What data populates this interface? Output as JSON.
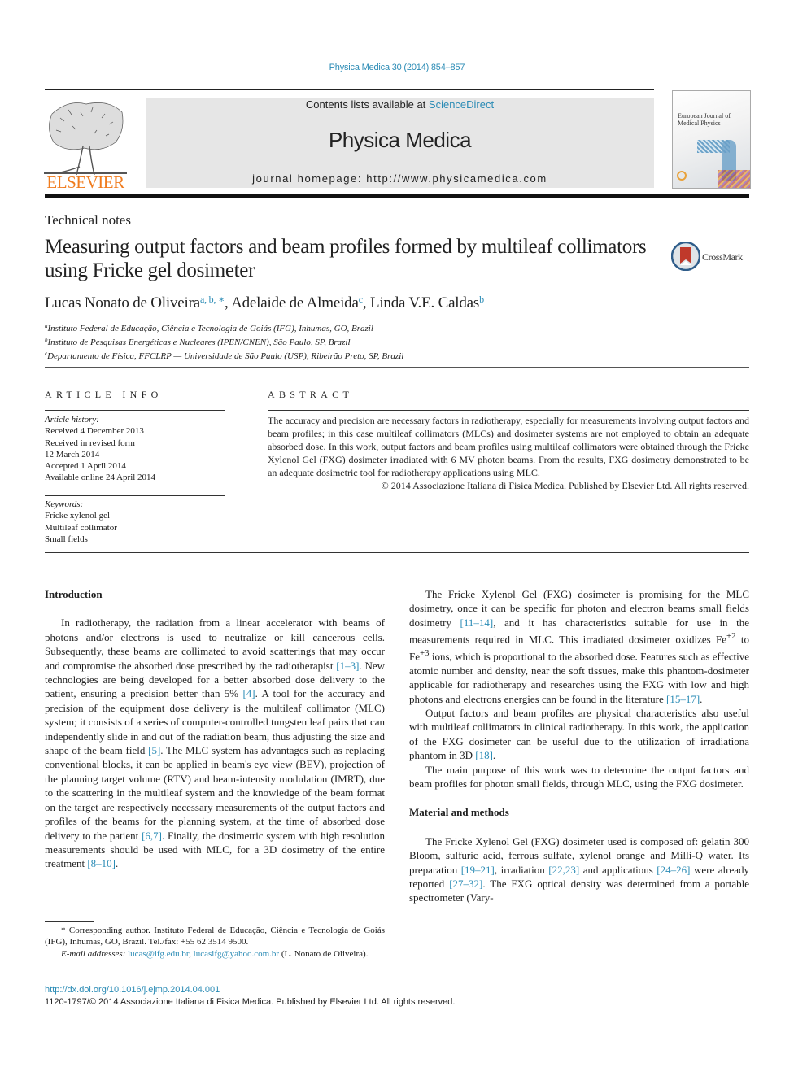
{
  "header": {
    "journal_ref": "Physica Medica 30 (2014) 854–857",
    "contents_prefix": "Contents lists available at ",
    "contents_link": "ScienceDirect",
    "journal_name": "Physica Medica",
    "homepage": "journal homepage: http://www.physicamedica.com",
    "publisher_logo_text": "ELSEVIER",
    "cover_title": "European Journal of Medical Physics",
    "accent_color": "#2a8bb5",
    "publisher_color": "#f07c1e"
  },
  "article": {
    "section_type": "Technical notes",
    "title": "Measuring output factors and beam profiles formed by multileaf collimators using Fricke gel dosimeter",
    "crossmark_label": "CrossMark",
    "authors": [
      {
        "name": "Lucas Nonato de Oliveira",
        "sup": "a, b, ∗",
        "sep": ", "
      },
      {
        "name": "Adelaide de Almeida",
        "sup": "c",
        "sep": ", "
      },
      {
        "name": "Linda V.E. Caldas",
        "sup": "b",
        "sep": ""
      }
    ],
    "affiliations": [
      {
        "mark": "a",
        "text": "Instituto Federal de Educação, Ciência e Tecnologia de Goiás (IFG), Inhumas, GO, Brazil"
      },
      {
        "mark": "b",
        "text": "Instituto de Pesquisas Energéticas e Nucleares (IPEN/CNEN), São Paulo, SP, Brazil"
      },
      {
        "mark": "c",
        "text": "Departamento de Física, FFCLRP — Universidade de São Paulo (USP), Ribeirão Preto, SP, Brazil"
      }
    ]
  },
  "article_info": {
    "heading": "ARTICLE INFO",
    "history_label": "Article history:",
    "history": [
      "Received 4 December 2013",
      "Received in revised form",
      "12 March 2014",
      "Accepted 1 April 2014",
      "Available online 24 April 2014"
    ],
    "keywords_label": "Keywords:",
    "keywords": [
      "Fricke xylenol gel",
      "Multileaf collimator",
      "Small fields"
    ]
  },
  "abstract": {
    "heading": "ABSTRACT",
    "text": "The accuracy and precision are necessary factors in radiotherapy, especially for measurements involving output factors and beam profiles; in this case multileaf collimators (MLCs) and dosimeter systems are not employed to obtain an adequate absorbed dose. In this work, output factors and beam profiles using multileaf collimators were obtained through the Fricke Xylenol Gel (FXG) dosimeter irradiated with 6 MV photon beams. From the results, FXG dosimetry demonstrated to be an adequate dosimetric tool for radiotherapy applications using MLC.",
    "copyright": "© 2014 Associazione Italiana di Fisica Medica. Published by Elsevier Ltd. All rights reserved."
  },
  "body": {
    "intro_heading": "Introduction",
    "intro_p1": [
      {
        "t": "In radiotherapy, the radiation from a linear accelerator with beams of photons and/or electrons is used to neutralize or kill cancerous cells. Subsequently, these beams are collimated to avoid scatterings that may occur and compromise the absorbed dose prescribed by the radiotherapist "
      },
      {
        "ref": "[1–3]"
      },
      {
        "t": ". New technologies are being developed for a better absorbed dose delivery to the patient, ensuring a precision better than 5% "
      },
      {
        "ref": "[4]"
      },
      {
        "t": ". A tool for the accuracy and precision of the equipment dose delivery is the multileaf collimator (MLC) system; it consists of a series of computer-controlled tungsten leaf pairs that can independently slide in and out of the radiation beam, thus adjusting the size and shape of the beam field "
      },
      {
        "ref": "[5]"
      },
      {
        "t": ". The MLC system has advantages such as replacing conventional blocks, it can be applied in beam's eye view (BEV), projection of the planning target volume (RTV) and beam-intensity modulation (IMRT), due to the scattering in the multileaf system and the knowledge of the beam format on the target are respectively necessary measurements of the output factors and profiles of the beams for the planning system, at the time of absorbed dose delivery to the patient "
      },
      {
        "ref": "[6,7]"
      },
      {
        "t": ". Finally, the dosimetric system with high resolution measurements should be used with MLC, for a 3D dosimetry of the entire treatment "
      },
      {
        "ref": "[8–10]"
      },
      {
        "t": "."
      }
    ],
    "intro_p2": [
      {
        "t": "The Fricke Xylenol Gel (FXG) dosimeter is promising for the MLC dosimetry, once it can be specific for photon and electron beams small fields dosimetry "
      },
      {
        "ref": "[11–14]"
      },
      {
        "t": ", and it has characteristics suitable for use in the measurements required in MLC. This irradiated dosimeter oxidizes Fe"
      },
      {
        "sup": "+2"
      },
      {
        "t": " to Fe"
      },
      {
        "sup": "+3"
      },
      {
        "t": " ions, which is proportional to the absorbed dose. Features such as effective atomic number and density, near the soft tissues, make this phantom-dosimeter applicable for radiotherapy and researches using the FXG with low and high photons and electrons energies can be found in the literature "
      },
      {
        "ref": "[15–17]"
      },
      {
        "t": "."
      }
    ],
    "intro_p3": [
      {
        "t": "Output factors and beam profiles are physical characteristics also useful with multileaf collimators in clinical radiotherapy. In this work, the application of the FXG dosimeter can be useful due to the utilization of irradiationa phantom in 3D "
      },
      {
        "ref": "[18]"
      },
      {
        "t": "."
      }
    ],
    "intro_p4": [
      {
        "t": "The main purpose of this work was to determine the output factors and beam profiles for photon small fields, through MLC, using the FXG dosimeter."
      }
    ],
    "methods_heading": "Material and methods",
    "methods_p1": [
      {
        "t": "The Fricke Xylenol Gel (FXG) dosimeter used is composed of: gelatin 300 Bloom, sulfuric acid, ferrous sulfate, xylenol orange and Milli-Q water. Its preparation "
      },
      {
        "ref": "[19–21]"
      },
      {
        "t": ", irradiation "
      },
      {
        "ref": "[22,23]"
      },
      {
        "t": " and applications "
      },
      {
        "ref": "[24–26]"
      },
      {
        "t": " were already reported "
      },
      {
        "ref": "[27–32]"
      },
      {
        "t": ". The FXG optical density was determined from a portable spectrometer (Vary-"
      }
    ]
  },
  "footnotes": {
    "corresponding": "* Corresponding author. Instituto Federal de Educação, Ciência e Tecnologia de Goiás (IFG), Inhumas, GO, Brazil. Tel./fax: +55 62 3514 9500.",
    "email_label": "E-mail addresses:",
    "emails": [
      "lucas@ifg.edu.br",
      "lucasifg@yahoo.com.br"
    ],
    "email_owner": "(L. Nonato de Oliveira)."
  },
  "footer": {
    "doi": "http://dx.doi.org/10.1016/j.ejmp.2014.04.001",
    "issn_line": "1120-1797/© 2014 Associazione Italiana di Fisica Medica. Published by Elsevier Ltd. All rights reserved."
  }
}
